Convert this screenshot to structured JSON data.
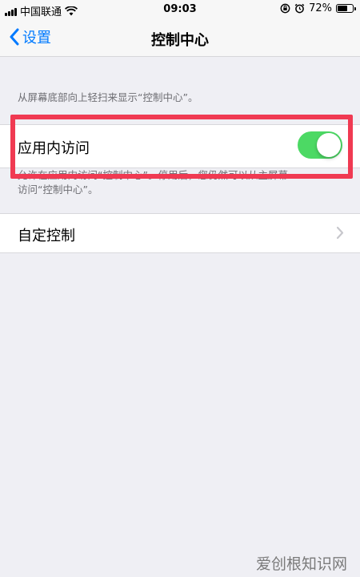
{
  "status_bar": {
    "carrier": "中国联通",
    "time": "09:03",
    "battery_percent": "72%",
    "battery_level": 0.72
  },
  "nav": {
    "back_label": "设置",
    "title": "控制中心"
  },
  "header_note": "从屏幕底部向上轻扫来显示“控制中心”。",
  "access_in_apps": {
    "label": "应用内访问",
    "enabled": true,
    "footer_line1": "允许在应用内访问“控制中心”。停用后，您仍然可以从主屏幕",
    "footer_line2": "访问“控制中心”。"
  },
  "customize": {
    "label": "自定控制"
  },
  "watermark": "爱创根知识网",
  "colors": {
    "accent": "#007aff",
    "toggle_on": "#4cd964",
    "highlight": "#f03a52"
  }
}
